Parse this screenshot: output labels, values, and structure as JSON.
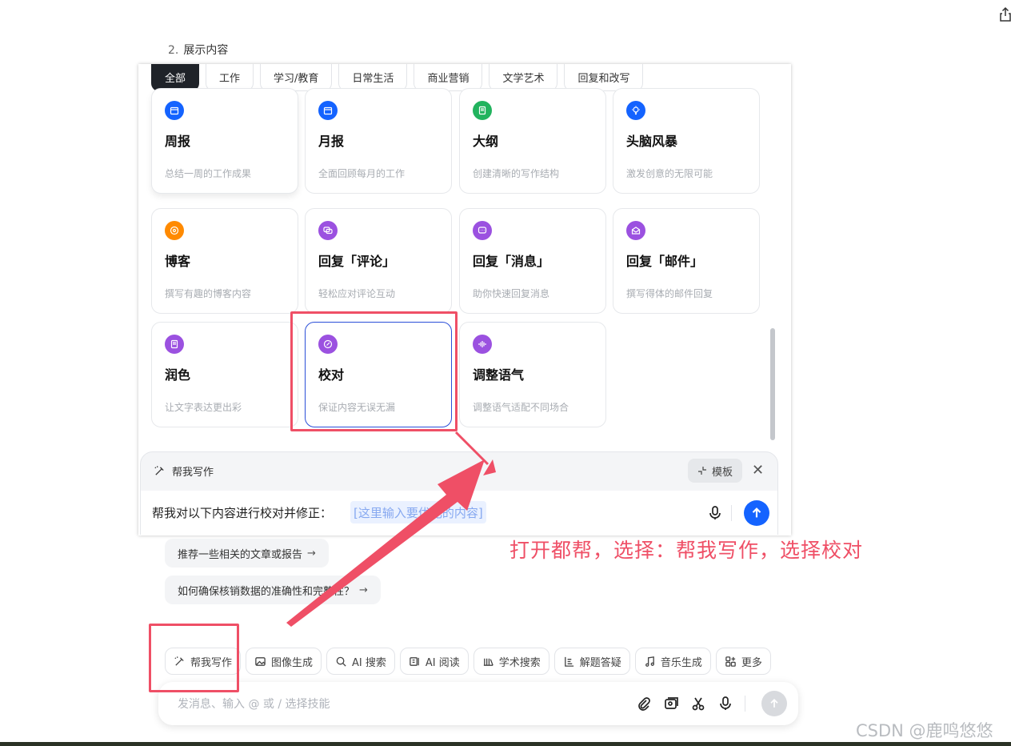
{
  "doc": {
    "step_number": "2.",
    "step_title": "展示内容"
  },
  "panel": {
    "tabs": [
      "全部",
      "工作",
      "学习/教育",
      "日常生活",
      "商业营销",
      "文学艺术",
      "回复和改写"
    ],
    "active_tab": "全部",
    "cards": [
      {
        "title": "周报",
        "desc": "总结一周的工作成果",
        "icon": "calendar-icon",
        "color": "#1463ff"
      },
      {
        "title": "月报",
        "desc": "全面回顾每月的工作",
        "icon": "calendar-icon",
        "color": "#1463ff"
      },
      {
        "title": "大纲",
        "desc": "创建清晰的写作结构",
        "icon": "document-icon",
        "color": "#22b35e"
      },
      {
        "title": "头脑风暴",
        "desc": "激发创意的无限可能",
        "icon": "lightbulb-icon",
        "color": "#1463ff"
      },
      {
        "title": "博客",
        "desc": "撰写有趣的博客内容",
        "icon": "compass-icon",
        "color": "#ff8a00"
      },
      {
        "title": "回复「评论」",
        "desc": "轻松应对评论互动",
        "icon": "comment-icon",
        "color": "#9b51e0"
      },
      {
        "title": "回复「消息」",
        "desc": "助你快速回复消息",
        "icon": "message-icon",
        "color": "#9b51e0"
      },
      {
        "title": "回复「邮件」",
        "desc": "撰写得体的邮件回复",
        "icon": "mail-icon",
        "color": "#9b51e0"
      },
      {
        "title": "润色",
        "desc": "让文字表达更出彩",
        "icon": "document-icon",
        "color": "#9b51e0"
      },
      {
        "title": "校对",
        "desc": "保证内容无误无漏",
        "icon": "check-circle-icon",
        "color": "#9b51e0"
      },
      {
        "title": "调整语气",
        "desc": "调整语气适配不同场合",
        "icon": "waveform-icon",
        "color": "#9b51e0"
      }
    ],
    "selected_card": "校对",
    "write_bar": {
      "label": "帮我写作",
      "template_label": "模板",
      "prompt": "帮我对以下内容进行校对并修正：",
      "slot_placeholder": "[这里输入要优化的内容]"
    }
  },
  "chat": {
    "suggestions": [
      {
        "text": "推荐一些相关的文章或报告",
        "arrow": "→"
      },
      {
        "text": "如何确保核销数据的准确性和完整性？",
        "arrow": "→"
      }
    ],
    "skills": [
      {
        "label": "帮我写作",
        "icon": "magic-pen-icon"
      },
      {
        "label": "图像生成",
        "icon": "image-icon"
      },
      {
        "label": "AI 搜索",
        "icon": "search-icon"
      },
      {
        "label": "AI 阅读",
        "icon": "reader-icon"
      },
      {
        "label": "学术搜索",
        "icon": "library-icon"
      },
      {
        "label": "解题答疑",
        "icon": "formula-icon"
      },
      {
        "label": "音乐生成",
        "icon": "music-icon"
      },
      {
        "label": "更多",
        "icon": "grid-plus-icon"
      }
    ],
    "input_placeholder": "发消息、输入 @ 或 / 选择技能"
  },
  "annotation": {
    "text": "打开都帮，选择：帮我写作，选择校对",
    "color": "#ef4f66"
  },
  "watermark": "CSDN @鹿鸣悠悠"
}
